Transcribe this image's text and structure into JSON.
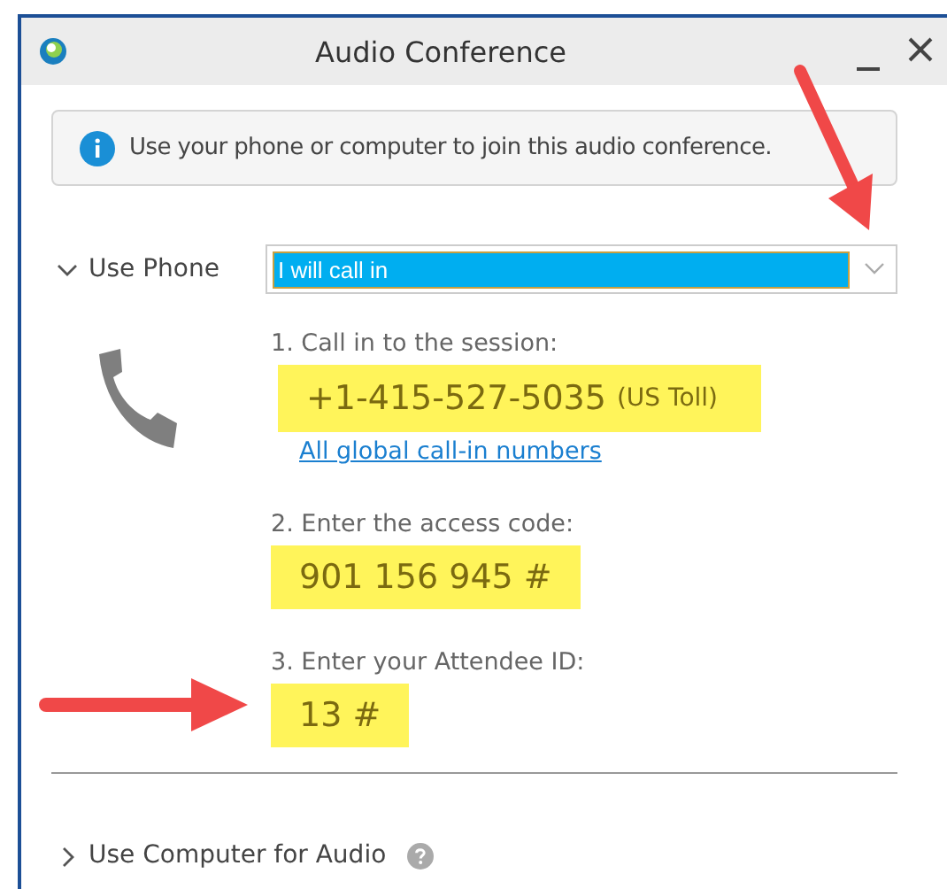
{
  "window": {
    "title": "Audio Conference"
  },
  "info": "Use your phone or computer to join this audio conference.",
  "phone_section": {
    "label": "Use Phone",
    "expanded": true,
    "dropdown": {
      "value": "I will call in"
    },
    "steps": [
      {
        "label": "1. Call in to the session:",
        "value": "+1-415-527-5035",
        "note": "(US Toll)",
        "link": "All global call-in numbers"
      },
      {
        "label": "2. Enter the access code:",
        "value": "901 156 945 #"
      },
      {
        "label": "3. Enter your Attendee ID:",
        "value": "13 #"
      }
    ]
  },
  "computer_section": {
    "label": "Use Computer for Audio",
    "expanded": false
  }
}
